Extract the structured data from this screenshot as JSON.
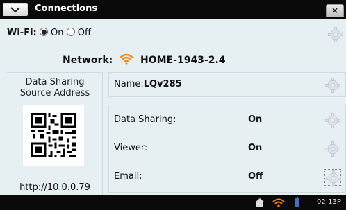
{
  "window": {
    "title": "Connections",
    "close_label": "×"
  },
  "wifi": {
    "label": "Wi-Fi:",
    "option_on": "On",
    "option_off": "Off",
    "selected": "On"
  },
  "network": {
    "label": "Network:",
    "ssid": "HOME-1943-2.4"
  },
  "data_sharing_source": {
    "title_line1": "Data Sharing",
    "title_line2": "Source Address",
    "url": "http://10.0.0.79"
  },
  "device": {
    "name_label": "Name:",
    "name_value": "LQv285"
  },
  "settings": [
    {
      "label": "Data Sharing:",
      "value": "On"
    },
    {
      "label": "Viewer:",
      "value": "On"
    },
    {
      "label": "Email:",
      "value": "Off"
    }
  ],
  "statusbar": {
    "time": "02:13P",
    "icons": [
      "home-icon",
      "wifi-icon",
      "battery-icon"
    ]
  },
  "colors": {
    "background": "#e6eff1",
    "titlebar": "#0a0a0a",
    "wifi_orange": "#f28a1a"
  }
}
